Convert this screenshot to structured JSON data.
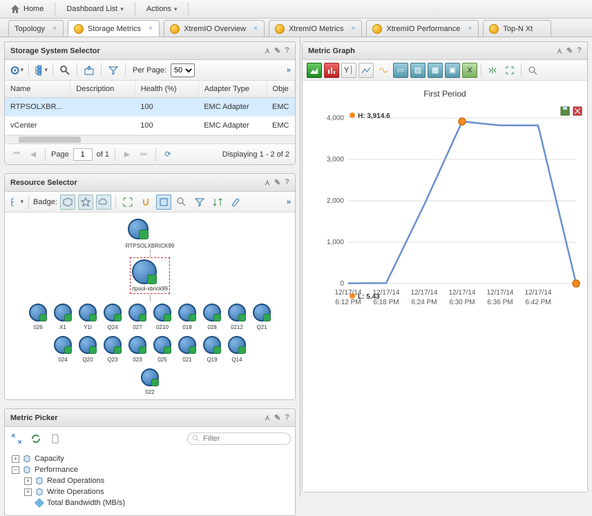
{
  "menubar": {
    "home": "Home",
    "dashboard": "Dashboard List",
    "actions": "Actions"
  },
  "tabs": [
    {
      "label": "Topology",
      "active": false,
      "icon": false
    },
    {
      "label": "Storage Metrics",
      "active": true,
      "icon": true
    },
    {
      "label": "XtremIO Overview",
      "active": false,
      "icon": true
    },
    {
      "label": "XtremIO Metrics",
      "active": false,
      "icon": true
    },
    {
      "label": "XtremIO Performance",
      "active": false,
      "icon": true
    },
    {
      "label": "Top-N Xt",
      "active": false,
      "icon": true
    }
  ],
  "storage_selector": {
    "title": "Storage System Selector",
    "per_page_label": "Per Page:",
    "per_page_value": "50",
    "columns": [
      "Name",
      "Description",
      "Health (%)",
      "Adapter Type",
      "Obje"
    ],
    "rows": [
      {
        "name": "RTPSOLXBR...",
        "desc": "",
        "health": "100",
        "adapter": "EMC Adapter",
        "obj": "EMC",
        "selected": true
      },
      {
        "name": "vCenter",
        "desc": "",
        "health": "100",
        "adapter": "EMC Adapter",
        "obj": "EMC",
        "selected": false
      }
    ],
    "pager": {
      "page_label": "Page",
      "page_value": "1",
      "of_label": "of 1",
      "display": "Displaying 1 - 2 of 2"
    }
  },
  "resource_selector": {
    "title": "Resource Selector",
    "badge_label": "Badge:",
    "root_label": "RTPSOLXBRICK99",
    "host_label": "rtpsol-xbrick99",
    "children_row1": [
      "026",
      "X1",
      "Y1l",
      "Q24",
      "027",
      "0210",
      "018",
      "028",
      "0212",
      "Q21"
    ],
    "children_row2": [
      "024",
      "Q20",
      "Q23",
      "023",
      "025",
      "021",
      "Q19",
      "Q14"
    ],
    "children_row3": [
      "022"
    ]
  },
  "metric_picker": {
    "title": "Metric Picker",
    "filter_placeholder": "Filter",
    "nodes": {
      "capacity": "Capacity",
      "performance": "Performance",
      "read_ops": "Read Operations",
      "write_ops": "Write Operations",
      "total_bw": "Total Bandwidth (MB/s)"
    }
  },
  "metric_graph": {
    "title": "Metric Graph",
    "chart_title": "First Period",
    "high_label": "H:",
    "high_value": "3,914.6",
    "low_label": "L:",
    "low_value": "5.43"
  },
  "chart_data": {
    "type": "line",
    "title": "First Period",
    "ylabel": "",
    "xlabel": "",
    "ylim": [
      0,
      4000
    ],
    "y_ticks": [
      0,
      1000,
      2000,
      3000,
      4000
    ],
    "categories": [
      "12/17/14 6:12 PM",
      "12/17/14 6:18 PM",
      "12/17/14 6:24 PM",
      "12/17/14 6:30 PM",
      "12/17/14 6:36 PM",
      "12/17/14 6:42 PM"
    ],
    "values": [
      5.43,
      10,
      1900,
      3914.6,
      3820,
      3820
    ],
    "extra_point_after_last": 0,
    "annotations": {
      "high": 3914.6,
      "low": 5.43
    }
  }
}
